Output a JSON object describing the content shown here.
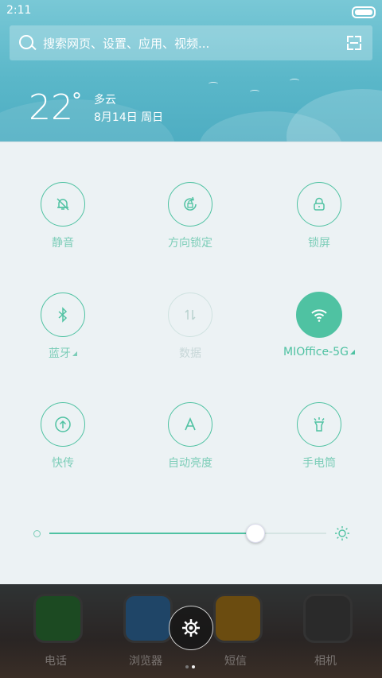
{
  "status": {
    "time": "2:11"
  },
  "search": {
    "placeholder": "搜索网页、设置、应用、视频..."
  },
  "weather": {
    "temperature": "22",
    "degree": "°",
    "condition": "多云",
    "date": "8月14日 周日"
  },
  "toggles": [
    {
      "label": "静音",
      "icon": "bell-off-icon",
      "state": "off"
    },
    {
      "label": "方向锁定",
      "icon": "rotation-lock-icon",
      "state": "off"
    },
    {
      "label": "锁屏",
      "icon": "lock-icon",
      "state": "off"
    },
    {
      "label": "蓝牙",
      "icon": "bluetooth-icon",
      "state": "off"
    },
    {
      "label": "数据",
      "icon": "data-icon",
      "state": "disabled"
    },
    {
      "label": "MIOffice-5G",
      "icon": "wifi-icon",
      "state": "on"
    },
    {
      "label": "快传",
      "icon": "transfer-icon",
      "state": "off"
    },
    {
      "label": "自动亮度",
      "icon": "auto-brightness-icon",
      "state": "off"
    },
    {
      "label": "手电筒",
      "icon": "flashlight-icon",
      "state": "off"
    }
  ],
  "brightness": {
    "level": 0.74
  },
  "dock": [
    {
      "label": "电话",
      "icon": "phone-icon",
      "color": "#2e8b2e"
    },
    {
      "label": "浏览器",
      "icon": "browser-icon",
      "color": "#2f7fc4"
    },
    {
      "label": "短信",
      "icon": "message-icon",
      "color": "#e3a21a"
    },
    {
      "label": "相机",
      "icon": "camera-icon",
      "color": "#3a3a3a"
    }
  ],
  "colors": {
    "accent": "#4fc2a2",
    "header": "#5ab7c9",
    "panel": "#ecf2f4"
  }
}
